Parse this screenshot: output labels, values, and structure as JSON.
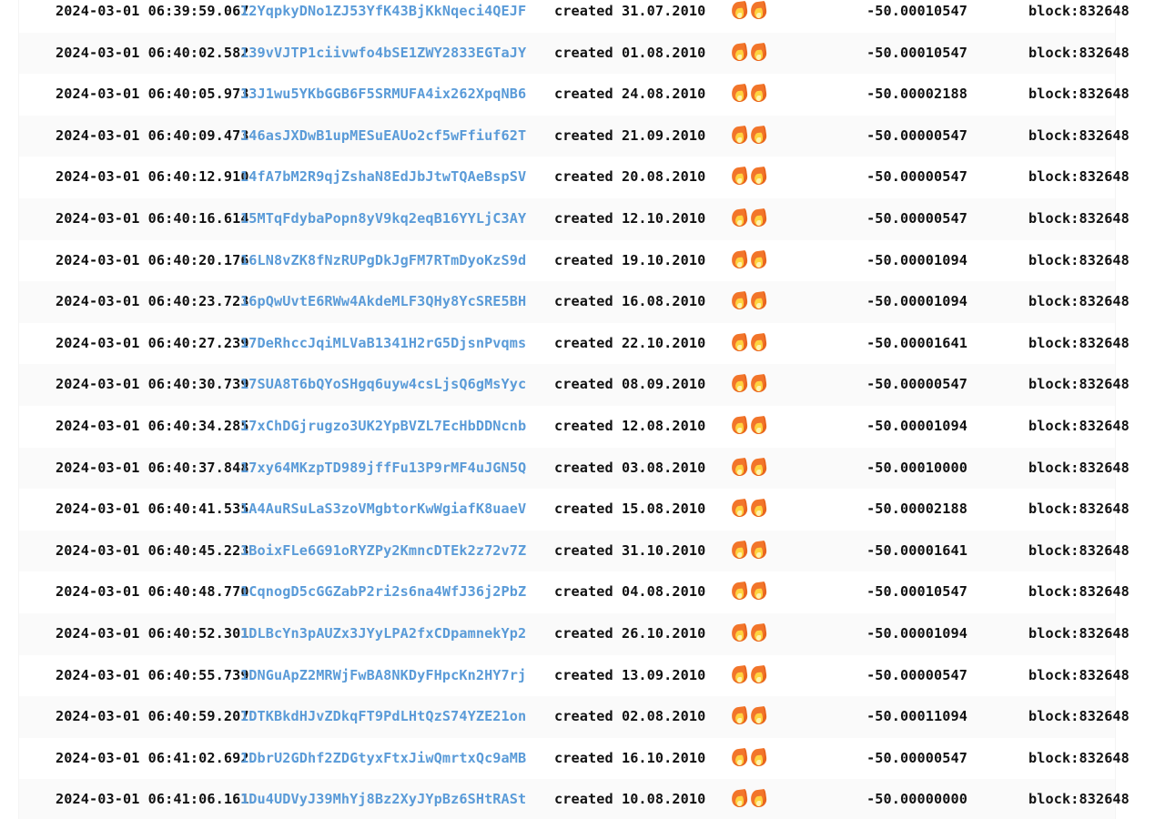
{
  "theme": {
    "background": "#ffffff",
    "text_color": "#111111",
    "link_color": "#5a9bd8",
    "row_alt_background": "#fafafa"
  },
  "log": {
    "icons": {
      "flame": "fire-icon"
    },
    "flame_count": 2,
    "rows": [
      {
        "timestamp": "2024-03-01 06:39:59.067",
        "address": "12YqpkyDNo1ZJ53YfK43BjKkNqeci4QEJF",
        "created": "created 31.07.2010",
        "amount": "-50.00010547",
        "block": "block:832648"
      },
      {
        "timestamp": "2024-03-01 06:40:02.582",
        "address": "139vVJTP1ciivwfo4bSE1ZWY2833EGTaJY",
        "created": "created 01.08.2010",
        "amount": "-50.00010547",
        "block": "block:832648"
      },
      {
        "timestamp": "2024-03-01 06:40:05.973",
        "address": "13J1wu5YKbGGB6F5SRMUFA4ix262XpqNB6",
        "created": "created 24.08.2010",
        "amount": "-50.00002188",
        "block": "block:832648"
      },
      {
        "timestamp": "2024-03-01 06:40:09.473",
        "address": "146asJXDwB1upMESuEAUo2cf5wFfiuf62T",
        "created": "created 21.09.2010",
        "amount": "-50.00000547",
        "block": "block:832648"
      },
      {
        "timestamp": "2024-03-01 06:40:12.910",
        "address": "14fA7bM2R9qjZshaN8EdJbJtwTQAeBspSV",
        "created": "created 20.08.2010",
        "amount": "-50.00000547",
        "block": "block:832648"
      },
      {
        "timestamp": "2024-03-01 06:40:16.614",
        "address": "15MTqFdybaPopn8yV9kq2eqB16YYLjC3AY",
        "created": "created 12.10.2010",
        "amount": "-50.00000547",
        "block": "block:832648"
      },
      {
        "timestamp": "2024-03-01 06:40:20.176",
        "address": "16LN8vZK8fNzRUPgDkJgFM7RTmDyoKzS9d",
        "created": "created 19.10.2010",
        "amount": "-50.00001094",
        "block": "block:832648"
      },
      {
        "timestamp": "2024-03-01 06:40:23.723",
        "address": "16pQwUvtE6RWw4AkdeMLF3QHy8YcSRE5BH",
        "created": "created 16.08.2010",
        "amount": "-50.00001094",
        "block": "block:832648"
      },
      {
        "timestamp": "2024-03-01 06:40:27.239",
        "address": "17DeRhccJqiMLVaB1341H2rG5DjsnPvqms",
        "created": "created 22.10.2010",
        "amount": "-50.00001641",
        "block": "block:832648"
      },
      {
        "timestamp": "2024-03-01 06:40:30.739",
        "address": "17SUA8T6bQYoSHgq6uyw4csLjsQ6gMsYyc",
        "created": "created 08.09.2010",
        "amount": "-50.00000547",
        "block": "block:832648"
      },
      {
        "timestamp": "2024-03-01 06:40:34.285",
        "address": "17xChDGjrugzo3UK2YpBVZL7EcHbDDNcnb",
        "created": "created 12.08.2010",
        "amount": "-50.00001094",
        "block": "block:832648"
      },
      {
        "timestamp": "2024-03-01 06:40:37.848",
        "address": "17xy64MKzpTD989jffFu13P9rMF4uJGN5Q",
        "created": "created 03.08.2010",
        "amount": "-50.00010000",
        "block": "block:832648"
      },
      {
        "timestamp": "2024-03-01 06:40:41.535",
        "address": "1A4AuRSuLaS3zoVMgbtorKwWgiafK8uaeV",
        "created": "created 15.08.2010",
        "amount": "-50.00002188",
        "block": "block:832648"
      },
      {
        "timestamp": "2024-03-01 06:40:45.223",
        "address": "1BoixFLe6G91oRYZPy2KmncDTEk2z72v7Z",
        "created": "created 31.10.2010",
        "amount": "-50.00001641",
        "block": "block:832648"
      },
      {
        "timestamp": "2024-03-01 06:40:48.770",
        "address": "1CqnogD5cGGZabP2ri2s6na4WfJ36j2PbZ",
        "created": "created 04.08.2010",
        "amount": "-50.00010547",
        "block": "block:832648"
      },
      {
        "timestamp": "2024-03-01 06:40:52.301",
        "address": "1DLBcYn3pAUZx3JYyLPA2fxCDpamnekYp2",
        "created": "created 26.10.2010",
        "amount": "-50.00001094",
        "block": "block:832648"
      },
      {
        "timestamp": "2024-03-01 06:40:55.739",
        "address": "1DNGuApZ2MRWjFwBA8NKDyFHpcKn2HY7rj",
        "created": "created 13.09.2010",
        "amount": "-50.00000547",
        "block": "block:832648"
      },
      {
        "timestamp": "2024-03-01 06:40:59.207",
        "address": "1DTKBkdHJvZDkqFT9PdLHtQzS74YZE21on",
        "created": "created 02.08.2010",
        "amount": "-50.00011094",
        "block": "block:832648"
      },
      {
        "timestamp": "2024-03-01 06:41:02.692",
        "address": "1DbrU2GDhf2ZDGtyxFtxJiwQmrtxQc9aMB",
        "created": "created 16.10.2010",
        "amount": "-50.00000547",
        "block": "block:832648"
      },
      {
        "timestamp": "2024-03-01 06:41:06.161",
        "address": "1Du4UDVyJ39MhYj8Bz2XyJYpBz6SHtRASt",
        "created": "created 10.08.2010",
        "amount": "-50.00000000",
        "block": "block:832648"
      }
    ]
  }
}
